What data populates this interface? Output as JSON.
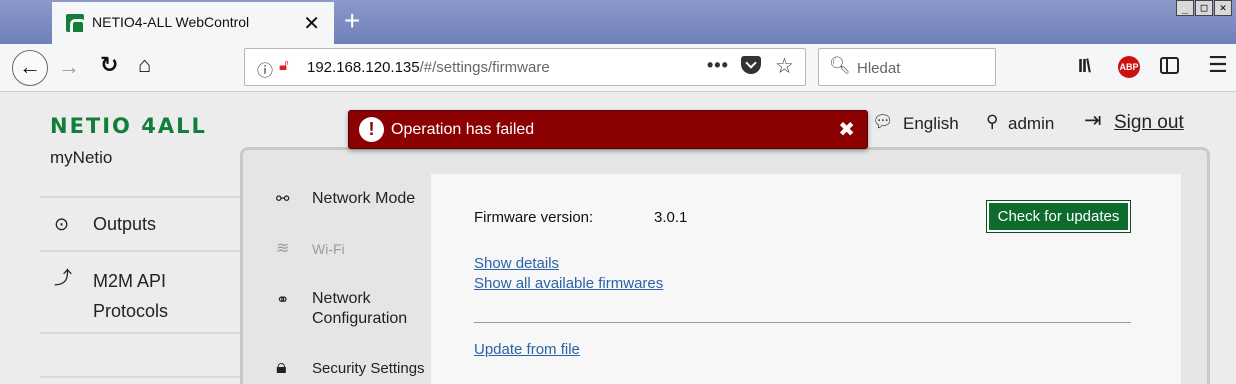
{
  "browser": {
    "tab": {
      "title": "NETIO4-ALL WebControl",
      "close_glyph": "✕",
      "favicon": "netio-favicon"
    },
    "new_tab_glyph": "+",
    "window_controls": [
      "_",
      "□",
      "✕"
    ],
    "nav": {
      "back": "←",
      "forward": "→",
      "reload": "↻",
      "home": "⌂"
    },
    "url": {
      "host": "192.168.120.135",
      "path": "/#/settings/firmware",
      "dots": "•••"
    },
    "search": {
      "placeholder": "Hledat"
    },
    "toolbar_icons": [
      "library-icon",
      "adblock-plus-icon",
      "sidebar-icon",
      "menu-icon"
    ],
    "abp_label": "ABP",
    "library_glyph": "II\\",
    "menu_glyph": "☰"
  },
  "header": {
    "logo": "NETIO 4ALL",
    "device_name": "myNetio",
    "language": "English",
    "user": "admin",
    "sign_out": "Sign out"
  },
  "sidebar": {
    "items": [
      {
        "label": "Outputs",
        "icon": "plug-icon"
      },
      {
        "label_line1": "M2M API",
        "label_line2": "Protocols",
        "icon": "m2m-icon"
      }
    ]
  },
  "settings_menu": {
    "items": [
      {
        "label": "Network Mode",
        "icon": "network-mode-icon",
        "enabled": true
      },
      {
        "label": "Wi-Fi",
        "icon": "wifi-icon",
        "enabled": false
      },
      {
        "label_line1": "Network",
        "label_line2": "Configuration",
        "icon": "network-config-icon",
        "enabled": true
      },
      {
        "label": "Security Settings",
        "icon": "lock-icon",
        "enabled": true
      }
    ]
  },
  "firmware": {
    "version_label": "Firmware version:",
    "version_value": "3.0.1",
    "check_button": "Check for updates",
    "show_details": "Show details",
    "show_all": "Show all available firmwares",
    "update_from_file": "Update from file"
  },
  "toast": {
    "message": "Operation has failed",
    "icon": "!",
    "close": "✖"
  },
  "colors": {
    "brand": "#137d3a",
    "error": "#8b0000",
    "link": "#2b63a8",
    "button": "#0d6b2d"
  }
}
